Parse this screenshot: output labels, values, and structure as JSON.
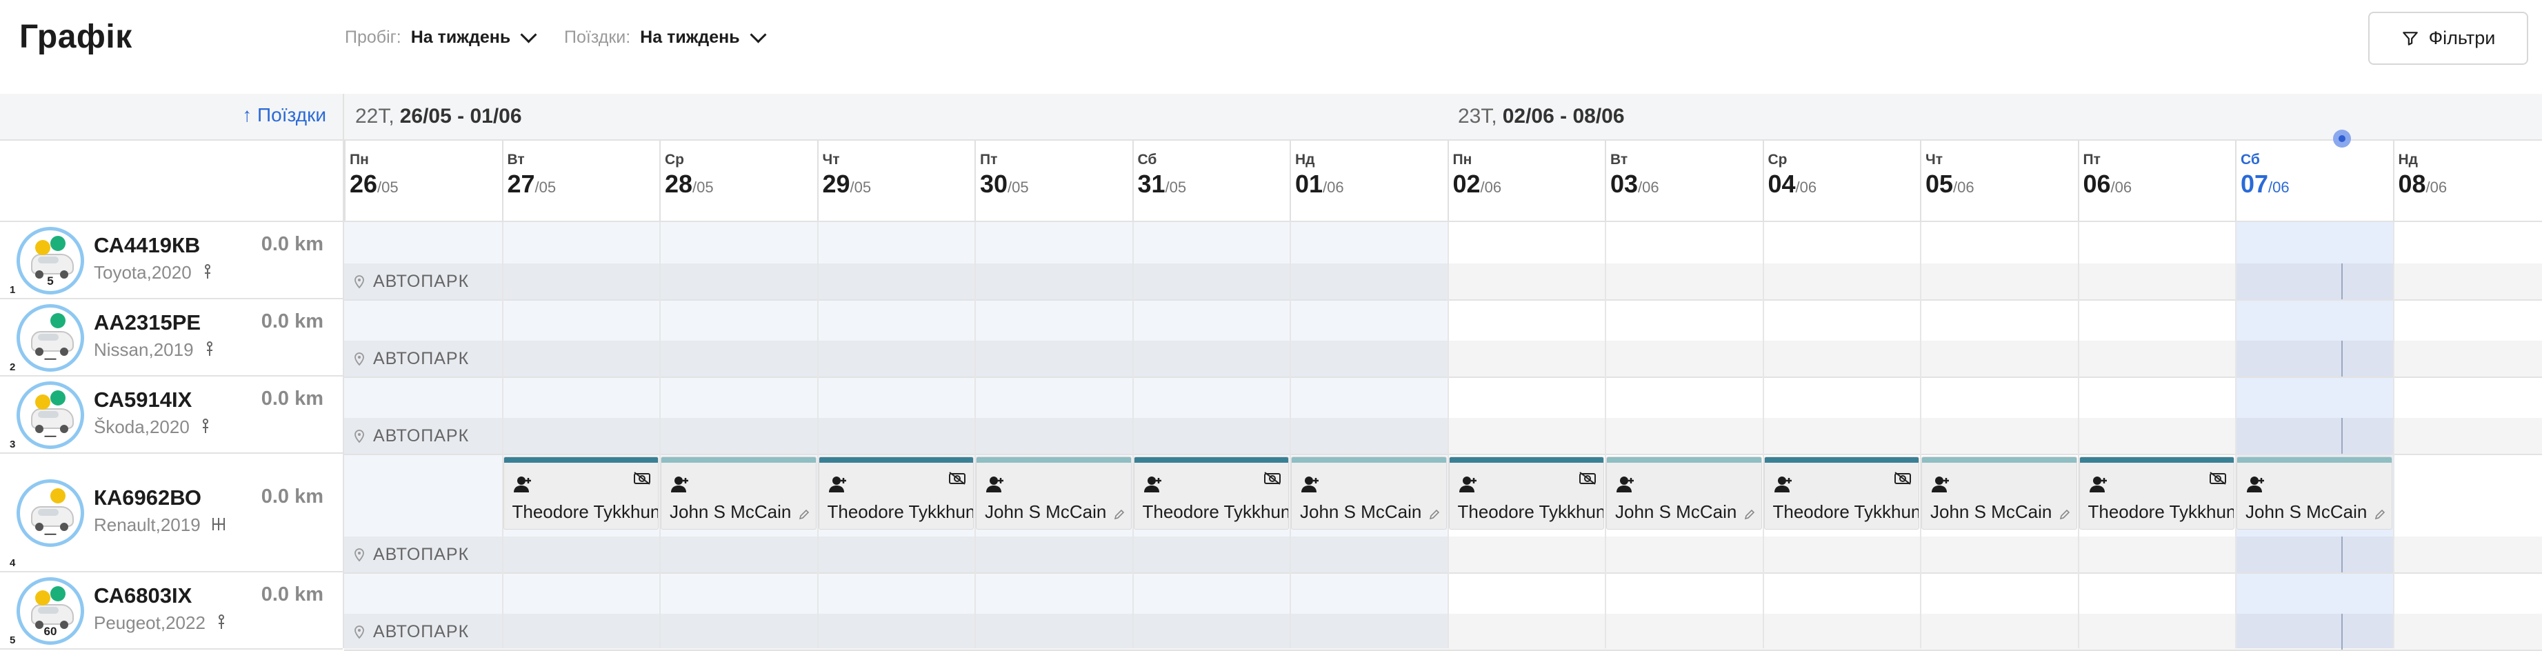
{
  "header": {
    "title": "Графік",
    "mileage_label": "Пробіг:",
    "mileage_value": "На тиждень",
    "trips_label": "Поїздки:",
    "trips_value": "На тиждень",
    "filters_label": "Фільтри"
  },
  "left": {
    "sort_link": "↑ Поїздки"
  },
  "weeks": [
    {
      "label": "22Т,",
      "range": "26/05 - 01/06"
    },
    {
      "label": "23Т,",
      "range": "02/06 - 08/06"
    }
  ],
  "days": [
    {
      "dow": "Пн",
      "day": "26",
      "month": "/05"
    },
    {
      "dow": "Вт",
      "day": "27",
      "month": "/05"
    },
    {
      "dow": "Ср",
      "day": "28",
      "month": "/05"
    },
    {
      "dow": "Чт",
      "day": "29",
      "month": "/05"
    },
    {
      "dow": "Пт",
      "day": "30",
      "month": "/05"
    },
    {
      "dow": "Сб",
      "day": "31",
      "month": "/05"
    },
    {
      "dow": "Нд",
      "day": "01",
      "month": "/06"
    },
    {
      "dow": "Пн",
      "day": "02",
      "month": "/06"
    },
    {
      "dow": "Вт",
      "day": "03",
      "month": "/06"
    },
    {
      "dow": "Ср",
      "day": "04",
      "month": "/06"
    },
    {
      "dow": "Чт",
      "day": "05",
      "month": "/06"
    },
    {
      "dow": "Пт",
      "day": "06",
      "month": "/06"
    },
    {
      "dow": "Сб",
      "day": "07",
      "month": "/06"
    },
    {
      "dow": "Нд",
      "day": "08",
      "month": "/06"
    }
  ],
  "today_index": 12,
  "location_label": "АВТОПАРК",
  "cars": [
    {
      "index": "1",
      "plate": "СА4419КВ",
      "model": "Toyota,2020",
      "km": "0.0 km",
      "avatar_num": "5",
      "transmission": "manual-gear-icon"
    },
    {
      "index": "2",
      "plate": "АА2315РЕ",
      "model": "Nissan,2019",
      "km": "0.0 km",
      "avatar_num": "—",
      "transmission": "manual-gear-icon"
    },
    {
      "index": "3",
      "plate": "СА5914ІХ",
      "model": "Škoda,2020",
      "km": "0.0 km",
      "avatar_num": "—",
      "transmission": "manual-gear-icon"
    },
    {
      "index": "4",
      "plate": "КА6962ВО",
      "model": "Renault,2019",
      "km": "0.0 km",
      "avatar_num": "—",
      "transmission": "automatic-gear-icon"
    },
    {
      "index": "5",
      "plate": "СА6803ІХ",
      "model": "Peugeot,2022",
      "km": "0.0 km",
      "avatar_num": "60",
      "transmission": "manual-gear-icon"
    }
  ],
  "trips": [
    {
      "day": 1,
      "name": "Theodore Tykkhun",
      "kind": "primary"
    },
    {
      "day": 2,
      "name": "John S McCain",
      "kind": "secondary"
    },
    {
      "day": 3,
      "name": "Theodore Tykkhun",
      "kind": "primary"
    },
    {
      "day": 4,
      "name": "John S McCain",
      "kind": "secondary"
    },
    {
      "day": 5,
      "name": "Theodore Tykkhun",
      "kind": "primary"
    },
    {
      "day": 6,
      "name": "John S McCain",
      "kind": "secondary"
    },
    {
      "day": 7,
      "name": "Theodore Tykkhun",
      "kind": "primary"
    },
    {
      "day": 8,
      "name": "John S McCain",
      "kind": "secondary"
    },
    {
      "day": 9,
      "name": "Theodore Tykkhun",
      "kind": "primary"
    },
    {
      "day": 10,
      "name": "John S McCain",
      "kind": "secondary"
    },
    {
      "day": 11,
      "name": "Theodore Tykkhun",
      "kind": "primary"
    },
    {
      "day": 12,
      "name": "John S McCain",
      "kind": "secondary"
    }
  ],
  "colors": {
    "accent": "#2a6ad7",
    "primary_bar": "#3a8095",
    "secondary_bar": "#8fbec3",
    "past_shade": "#f2f5fa",
    "today_shade": "#e6edfb"
  }
}
